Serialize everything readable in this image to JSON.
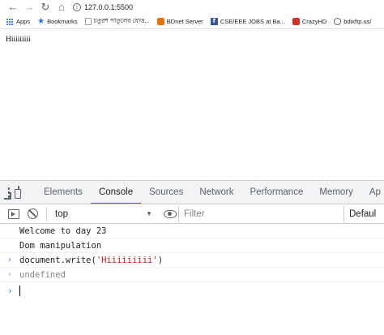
{
  "browser": {
    "url": "127.0.0.1:5500",
    "bookmarks": [
      {
        "label": "Apps",
        "icon": "apps-icon"
      },
      {
        "label": "Bookmarks",
        "icon": "star-icon"
      },
      {
        "label": "চতুরশ পাতুলের যোত্ত...",
        "icon": "document-icon"
      },
      {
        "label": "BDnet Server",
        "icon": "bdnet-icon"
      },
      {
        "label": "CSE/EEE JOBS at Ba...",
        "icon": "facebook-icon"
      },
      {
        "label": "CrazyHD",
        "icon": "crazyhd-icon"
      },
      {
        "label": "bdixftp.us/",
        "icon": "globe-icon"
      }
    ]
  },
  "page": {
    "text": "Hiiiiiiiii"
  },
  "devtools": {
    "tabs": [
      {
        "label": "Elements",
        "active": false
      },
      {
        "label": "Console",
        "active": true
      },
      {
        "label": "Sources",
        "active": false
      },
      {
        "label": "Network",
        "active": false
      },
      {
        "label": "Performance",
        "active": false
      },
      {
        "label": "Memory",
        "active": false
      },
      {
        "label": "Ap",
        "active": false
      }
    ],
    "toolbar": {
      "context": "top",
      "filter_placeholder": "Filter",
      "levels": "Defaul"
    },
    "console": {
      "log1": "Welcome to day 23",
      "log2": "Dom manipulation",
      "input_prefix": "document.write(",
      "input_string": "'Hiiiiiiiii'",
      "input_suffix": ")",
      "result": "undefined"
    },
    "colors": {
      "accent": "#1a73e8",
      "string": "#c41a16"
    }
  }
}
